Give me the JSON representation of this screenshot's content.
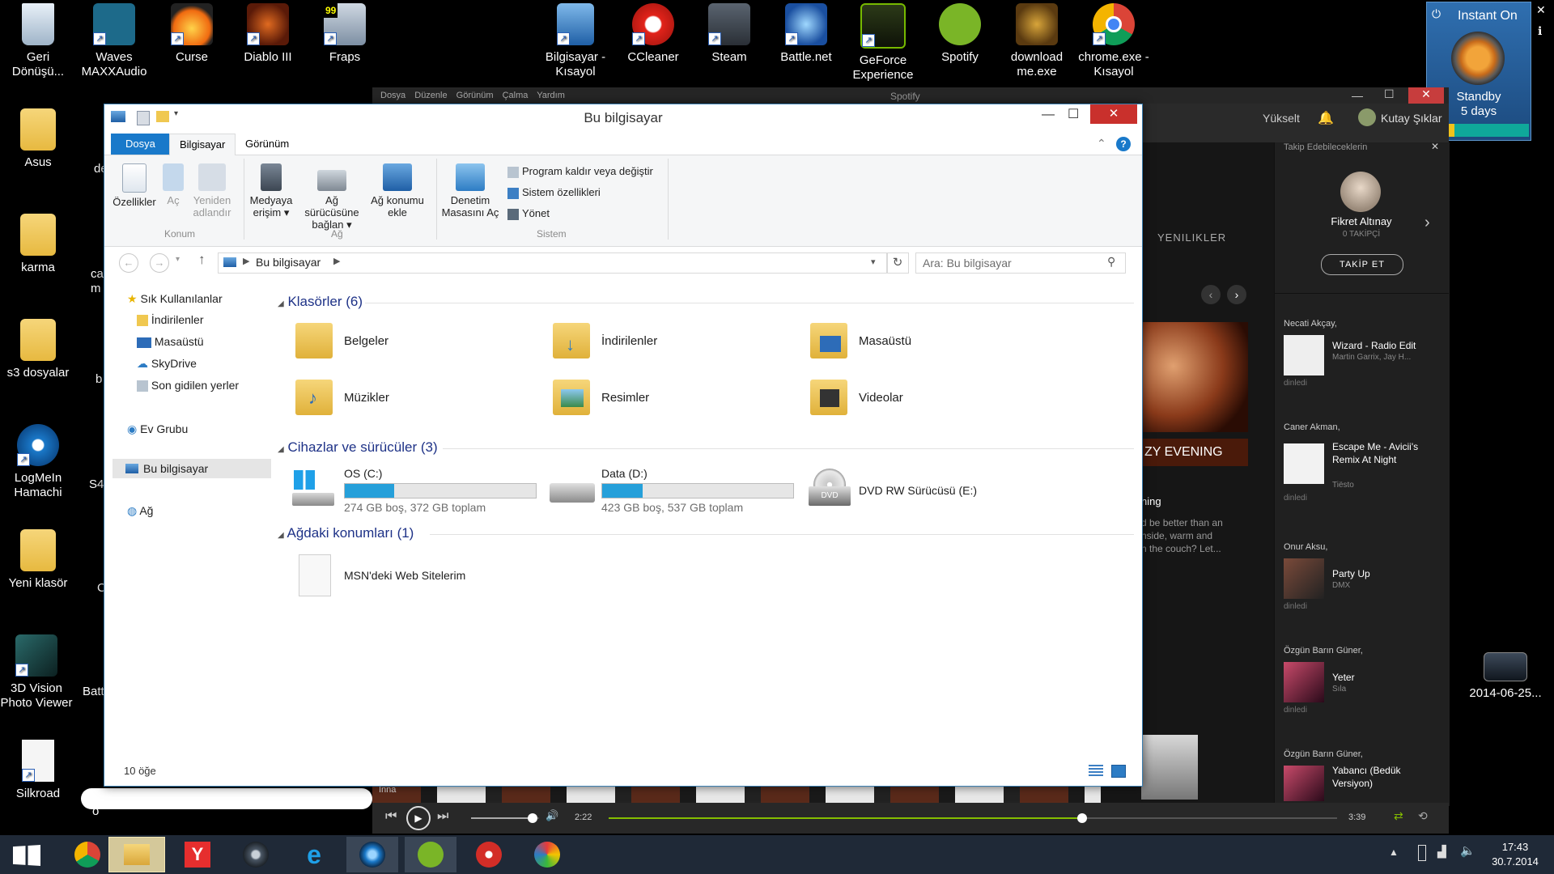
{
  "desktop": {
    "icons_top": [
      {
        "label": "Geri Dönüşü...",
        "icon": "recycle-bin-icon"
      },
      {
        "label": "Waves MAXXAudio",
        "icon": "waves-icon"
      },
      {
        "label": "Curse",
        "icon": "curse-flame-icon"
      },
      {
        "label": "Diablo III",
        "icon": "diablo-icon"
      },
      {
        "label": "Fraps",
        "icon": "fraps-icon"
      },
      {
        "label": "Bilgisayar - Kısayol",
        "icon": "computer-icon"
      },
      {
        "label": "CCleaner",
        "icon": "ccleaner-icon"
      },
      {
        "label": "Steam",
        "icon": "steam-icon"
      },
      {
        "label": "Battle.net",
        "icon": "battlenet-icon"
      },
      {
        "label": "GeForce Experience",
        "icon": "geforce-icon"
      },
      {
        "label": "Spotify",
        "icon": "spotify-icon"
      },
      {
        "label": "download me.exe",
        "icon": "hon-icon"
      },
      {
        "label": "chrome.exe - Kısayol",
        "icon": "chrome-icon"
      }
    ],
    "icons_left": [
      {
        "label": "Asus",
        "icon": "folder-icon"
      },
      {
        "label": "karma",
        "icon": "folder-icon"
      },
      {
        "label": "s3 dosyalar",
        "icon": "folder-icon"
      },
      {
        "label": "LogMeIn Hamachi",
        "icon": "hamachi-icon"
      },
      {
        "label": "Yeni klasör",
        "icon": "folder-icon"
      },
      {
        "label": "3D Vision Photo Viewer",
        "icon": "3d-vision-icon"
      },
      {
        "label": "Silkroad",
        "icon": "file-icon"
      }
    ],
    "partial_labels": [
      "de",
      "ca m",
      "b",
      "S4",
      "C",
      "Batt",
      "ö"
    ],
    "bottom_right_icon_label": "2014-06-25..."
  },
  "instant_on": {
    "title": "Instant On",
    "status": "Standby",
    "duration": "5 days"
  },
  "spotify": {
    "menu": [
      "Dosya",
      "Düzenle",
      "Görünüm",
      "Çalma",
      "Yardım"
    ],
    "title": "Spotify",
    "upgrade": "Yükselt",
    "user": "Kutay Şıklar",
    "tab_new": "YENILIKLER",
    "banner_text": "ZY EVENING",
    "desc_heading": "ning",
    "desc_lines": [
      "d be better than an",
      "nside, warm and",
      "n the couch? Let..."
    ],
    "small_label": "Inna",
    "player": {
      "elapsed": "2:22",
      "total": "3:39",
      "volume_fraction": 0.9,
      "progress_fraction": 0.65
    },
    "suggest": {
      "header": "Takip Edebileceklerin",
      "name": "Fikret Altınay",
      "followers": "0 TAKİPÇİ",
      "follow_button": "TAKİP ET"
    },
    "feed": [
      {
        "user": "Necati Akçay,",
        "track": "Wizard - Radio Edit",
        "artist": "Martin Garrix, Jay H...",
        "action": "dinledi"
      },
      {
        "user": "Caner Akman,",
        "track": "Escape Me - Avicii's Remix At Night",
        "artist": "Tiësto",
        "action": "dinledi"
      },
      {
        "user": "Onur Aksu,",
        "track": "Party Up",
        "artist": "DMX",
        "action": "dinledi"
      },
      {
        "user": "Özgün Barın Güner,",
        "track": "Yeter",
        "artist": "Sıla",
        "action": "dinledi"
      },
      {
        "user": "Özgün Barın Güner,",
        "track": "Yabancı (Bedük Versiyon)",
        "artist": "",
        "action": ""
      }
    ]
  },
  "explorer": {
    "title": "Bu bilgisayar",
    "tabs": [
      "Dosya",
      "Bilgisayar",
      "Görünüm"
    ],
    "ribbon": {
      "konum": {
        "label": "Konum",
        "buttons": [
          "Özellikler",
          "Aç",
          "Yeniden adlandır"
        ]
      },
      "ag": {
        "label": "Ağ",
        "buttons": [
          "Medyaya erişim",
          "Ağ sürücüsüne bağlan",
          "Ağ konumu ekle"
        ]
      },
      "sistem": {
        "label": "Sistem",
        "big": "Denetim Masasını Aç",
        "items": [
          "Program kaldır veya değiştir",
          "Sistem özellikleri",
          "Yönet"
        ]
      }
    },
    "address": "Bu bilgisayar",
    "search_placeholder": "Ara: Bu bilgisayar",
    "nav": {
      "favorites": "Sık Kullanılanlar",
      "fav_items": [
        "İndirilenler",
        "Masaüstü",
        "SkyDrive",
        "Son gidilen yerler"
      ],
      "homegroup": "Ev Grubu",
      "this_pc": "Bu bilgisayar",
      "network": "Ağ"
    },
    "folders_header": "Klasörler (6)",
    "folders": [
      "Belgeler",
      "İndirilenler",
      "Masaüstü",
      "Müzikler",
      "Resimler",
      "Videolar"
    ],
    "devices_header": "Cihazlar ve sürücüler (3)",
    "drives": [
      {
        "name": "OS (C:)",
        "info": "274 GB boş, 372 GB toplam",
        "used_fraction": 0.26
      },
      {
        "name": "Data (D:)",
        "info": "423 GB boş, 537 GB toplam",
        "used_fraction": 0.21
      },
      {
        "name": "DVD RW Sürücüsü (E:)"
      }
    ],
    "network_header": "Ağdaki konumları (1)",
    "network_items": [
      "MSN'deki Web Sitelerim"
    ],
    "status": "10 öğe"
  },
  "taskbar": {
    "time": "17:43",
    "date": "30.7.2014",
    "apps": [
      "start-icon",
      "chrome-icon",
      "file-explorer-icon",
      "yandex-icon",
      "steam-icon",
      "internet-explorer-icon",
      "instant-on-icon",
      "spotify-icon",
      "lastpass-icon",
      "paint-icon"
    ]
  }
}
